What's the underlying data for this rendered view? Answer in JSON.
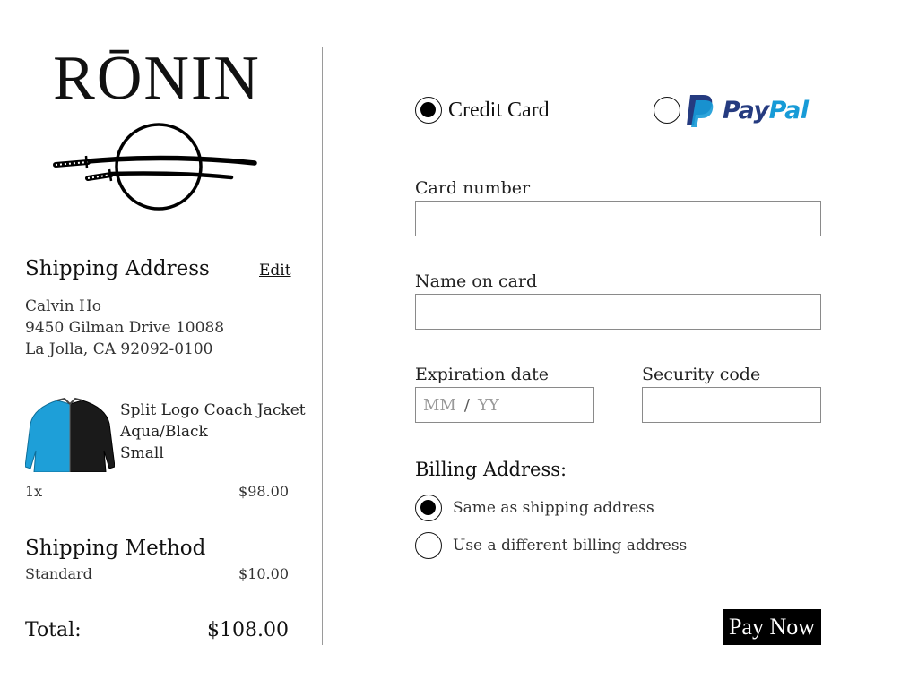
{
  "brand": {
    "name": "RŌNIN"
  },
  "shipping_address": {
    "heading": "Shipping Address",
    "edit_label": "Edit",
    "name": "Calvin Ho",
    "line1": "9450 Gilman Drive 10088",
    "line2": "La Jolla, CA 92092-0100"
  },
  "cart": {
    "item": {
      "name": "Split Logo Coach Jacket",
      "color": "Aqua/Black",
      "size": "Small",
      "quantity": "1x",
      "price": "$98.00",
      "image_icon": "jacket-image",
      "colors": {
        "aqua": "#1e9fd8",
        "black": "#1a1a1a"
      }
    }
  },
  "shipping_method": {
    "heading": "Shipping Method",
    "name": "Standard",
    "price": "$10.00"
  },
  "total": {
    "label": "Total:",
    "value": "$108.00"
  },
  "payment": {
    "options": [
      {
        "label": "Credit Card",
        "selected": true
      },
      {
        "label": "PayPal",
        "selected": false,
        "logo_colors": {
          "dark": "#253b80",
          "light": "#179bd7"
        }
      }
    ],
    "card_number": {
      "label": "Card number",
      "value": ""
    },
    "name_on_card": {
      "label": "Name on card",
      "value": ""
    },
    "expiration": {
      "label": "Expiration date",
      "month_placeholder": "MM",
      "separator": "/",
      "year_placeholder": "YY"
    },
    "security_code": {
      "label": "Security code",
      "value": ""
    }
  },
  "billing": {
    "heading": "Billing Address:",
    "options": [
      {
        "label": "Same as shipping address",
        "selected": true
      },
      {
        "label": "Use a different billing address",
        "selected": false
      }
    ]
  },
  "actions": {
    "pay_now": "Pay Now"
  }
}
